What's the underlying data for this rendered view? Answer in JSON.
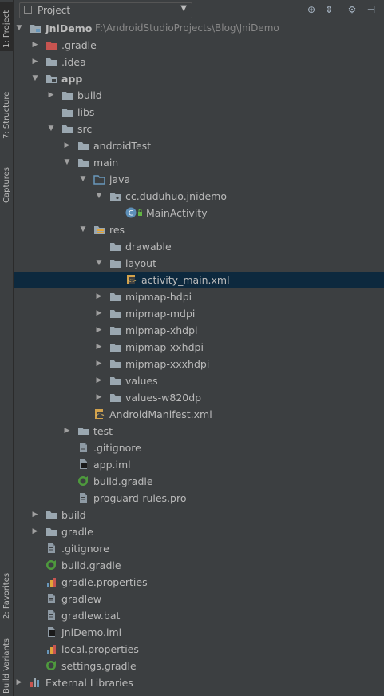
{
  "tool_window_tabs": [
    {
      "label": "1: Project",
      "active": true
    },
    {
      "label": "7: Structure",
      "active": false
    },
    {
      "label": "Captures",
      "active": false
    },
    {
      "label": "2: Favorites",
      "active": false
    },
    {
      "label": "Build Variants",
      "active": false
    }
  ],
  "header": {
    "view_label": "Project",
    "buttons": [
      "locate-icon",
      "collapse-all-icon",
      "settings-icon",
      "hide-icon"
    ]
  },
  "colors": {
    "background": "#3c3f41",
    "selection": "#0d293e",
    "folder": "#9aa7b0",
    "source_folder": "#6897bb",
    "excluded_folder": "#c75450"
  },
  "tree": [
    {
      "name": "JniDemo",
      "path": "F:\\AndroidStudioProjects\\Blog\\JniDemo",
      "depth": 0,
      "expand": "open",
      "icon": "project-folder",
      "bold": true
    },
    {
      "name": ".gradle",
      "depth": 1,
      "expand": "closed",
      "icon": "folder-excluded"
    },
    {
      "name": ".idea",
      "depth": 1,
      "expand": "closed",
      "icon": "folder"
    },
    {
      "name": "app",
      "depth": 1,
      "expand": "open",
      "icon": "module-folder",
      "bold": true
    },
    {
      "name": "build",
      "depth": 2,
      "expand": "closed",
      "icon": "folder"
    },
    {
      "name": "libs",
      "depth": 2,
      "expand": "none",
      "icon": "folder"
    },
    {
      "name": "src",
      "depth": 2,
      "expand": "open",
      "icon": "folder"
    },
    {
      "name": "androidTest",
      "depth": 3,
      "expand": "closed",
      "icon": "folder"
    },
    {
      "name": "main",
      "depth": 3,
      "expand": "open",
      "icon": "folder"
    },
    {
      "name": "java",
      "depth": 4,
      "expand": "open",
      "icon": "source-folder"
    },
    {
      "name": "cc.duduhuo.jnidemo",
      "depth": 5,
      "expand": "open",
      "icon": "package"
    },
    {
      "name": "MainActivity",
      "depth": 6,
      "expand": "none",
      "icon": "class"
    },
    {
      "name": "res",
      "depth": 4,
      "expand": "open",
      "icon": "res-folder"
    },
    {
      "name": "drawable",
      "depth": 5,
      "expand": "none",
      "icon": "folder"
    },
    {
      "name": "layout",
      "depth": 5,
      "expand": "open",
      "icon": "folder"
    },
    {
      "name": "activity_main.xml",
      "depth": 6,
      "expand": "none",
      "icon": "xml-file",
      "selected": true
    },
    {
      "name": "mipmap-hdpi",
      "depth": 5,
      "expand": "closed",
      "icon": "folder"
    },
    {
      "name": "mipmap-mdpi",
      "depth": 5,
      "expand": "closed",
      "icon": "folder"
    },
    {
      "name": "mipmap-xhdpi",
      "depth": 5,
      "expand": "closed",
      "icon": "folder"
    },
    {
      "name": "mipmap-xxhdpi",
      "depth": 5,
      "expand": "closed",
      "icon": "folder"
    },
    {
      "name": "mipmap-xxxhdpi",
      "depth": 5,
      "expand": "closed",
      "icon": "folder"
    },
    {
      "name": "values",
      "depth": 5,
      "expand": "closed",
      "icon": "folder"
    },
    {
      "name": "values-w820dp",
      "depth": 5,
      "expand": "closed",
      "icon": "folder"
    },
    {
      "name": "AndroidManifest.xml",
      "depth": 4,
      "expand": "none",
      "icon": "xml-file"
    },
    {
      "name": "test",
      "depth": 3,
      "expand": "closed",
      "icon": "folder"
    },
    {
      "name": ".gitignore",
      "depth": 3,
      "expand": "none",
      "icon": "text-file"
    },
    {
      "name": "app.iml",
      "depth": 3,
      "expand": "none",
      "icon": "iml-file"
    },
    {
      "name": "build.gradle",
      "depth": 3,
      "expand": "none",
      "icon": "gradle-file"
    },
    {
      "name": "proguard-rules.pro",
      "depth": 3,
      "expand": "none",
      "icon": "text-file"
    },
    {
      "name": "build",
      "depth": 1,
      "expand": "closed",
      "icon": "folder"
    },
    {
      "name": "gradle",
      "depth": 1,
      "expand": "closed",
      "icon": "folder"
    },
    {
      "name": ".gitignore",
      "depth": 1,
      "expand": "none",
      "icon": "text-file"
    },
    {
      "name": "build.gradle",
      "depth": 1,
      "expand": "none",
      "icon": "gradle-file"
    },
    {
      "name": "gradle.properties",
      "depth": 1,
      "expand": "none",
      "icon": "properties-file"
    },
    {
      "name": "gradlew",
      "depth": 1,
      "expand": "none",
      "icon": "text-file"
    },
    {
      "name": "gradlew.bat",
      "depth": 1,
      "expand": "none",
      "icon": "text-file"
    },
    {
      "name": "JniDemo.iml",
      "depth": 1,
      "expand": "none",
      "icon": "iml-file"
    },
    {
      "name": "local.properties",
      "depth": 1,
      "expand": "none",
      "icon": "properties-file"
    },
    {
      "name": "settings.gradle",
      "depth": 1,
      "expand": "none",
      "icon": "gradle-file"
    },
    {
      "name": "External Libraries",
      "depth": 0,
      "expand": "closed",
      "icon": "libraries"
    }
  ]
}
